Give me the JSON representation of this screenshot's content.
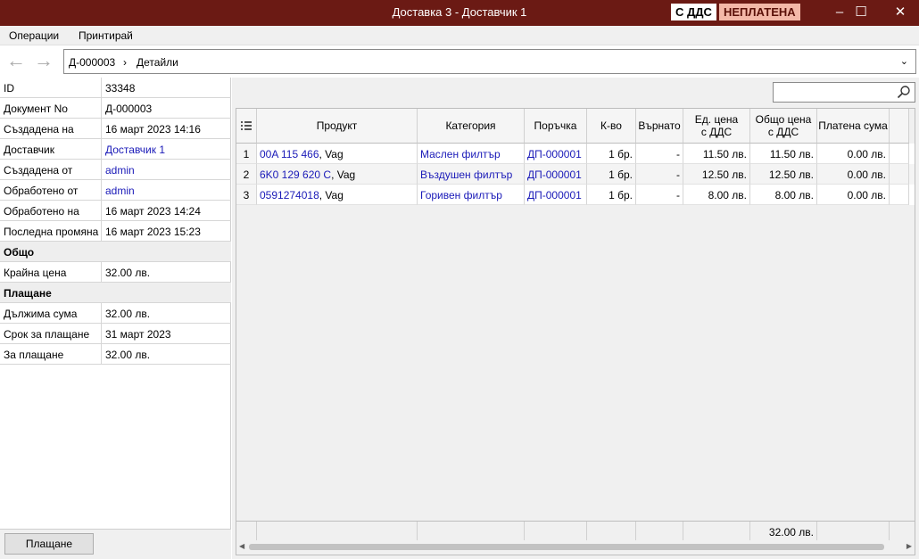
{
  "window": {
    "title": "Доставка 3 - Доставчик 1",
    "badge_vat": "С ДДС",
    "badge_status": "НЕПЛАТЕНА",
    "minimize": "–",
    "maximize": "☐",
    "close": "✕"
  },
  "menu": {
    "operations": "Операции",
    "print": "Принтирай"
  },
  "nav": {
    "back_icon": "←",
    "forward_icon": "→",
    "crumb_doc": "Д-000003",
    "crumb_sep": "›",
    "crumb_page": "Детайли",
    "dropdown_icon": "⌄"
  },
  "props": {
    "id": {
      "label": "ID",
      "value": "33348"
    },
    "doc_no": {
      "label": "Документ No",
      "value": "Д-000003"
    },
    "created_on": {
      "label": "Създадена на",
      "value": "16 март 2023 14:16"
    },
    "supplier": {
      "label": "Доставчик",
      "value": "Доставчик 1"
    },
    "created_by": {
      "label": "Създадена от",
      "value": "admin"
    },
    "processed_by": {
      "label": "Обработено от",
      "value": "admin"
    },
    "processed_on": {
      "label": "Обработено на",
      "value": "16 март 2023 14:24"
    },
    "last_change": {
      "label": "Последна промяна",
      "value": "16 март 2023 15:23"
    },
    "section_total": "Общо",
    "final_price": {
      "label": "Крайна цена",
      "value": "32.00 лв."
    },
    "section_payment": "Плащане",
    "due_amount": {
      "label": "Дължима сума",
      "value": "32.00 лв."
    },
    "payment_term": {
      "label": "Срок за плащане",
      "value": "31 март 2023"
    },
    "to_pay": {
      "label": "За плащане",
      "value": "32.00 лв."
    }
  },
  "payment_button": "Плащане",
  "grid": {
    "headers": {
      "product": "Продукт",
      "category": "Категория",
      "order": "Поръчка",
      "qty": "К-во",
      "returned": "Върнато",
      "unit_price_1": "Ед. цена",
      "unit_price_2": "с ДДС",
      "total_1": "Общо цена",
      "total_2": "с ДДС",
      "paid": "Платена сума"
    },
    "rows": [
      {
        "n": "1",
        "product_code": "00A 115 466",
        "product_brand": ", Vag",
        "category": "Маслен филтър",
        "order": "ДП-000001",
        "qty": "1 бр.",
        "returned": "-",
        "unit_price": "11.50 лв.",
        "total": "11.50 лв.",
        "paid": "0.00 лв."
      },
      {
        "n": "2",
        "product_code": "6K0 129 620 C",
        "product_brand": ", Vag",
        "category": "Въздушен филтър",
        "order": "ДП-000001",
        "qty": "1 бр.",
        "returned": "-",
        "unit_price": "12.50 лв.",
        "total": "12.50 лв.",
        "paid": "0.00 лв."
      },
      {
        "n": "3",
        "product_code": "0591274018",
        "product_brand": ", Vag",
        "category": "Горивен филтър",
        "order": "ДП-000001",
        "qty": "1 бр.",
        "returned": "-",
        "unit_price": "8.00 лв.",
        "total": "8.00 лв.",
        "paid": "0.00 лв."
      }
    ],
    "footer_total": "32.00 лв."
  }
}
